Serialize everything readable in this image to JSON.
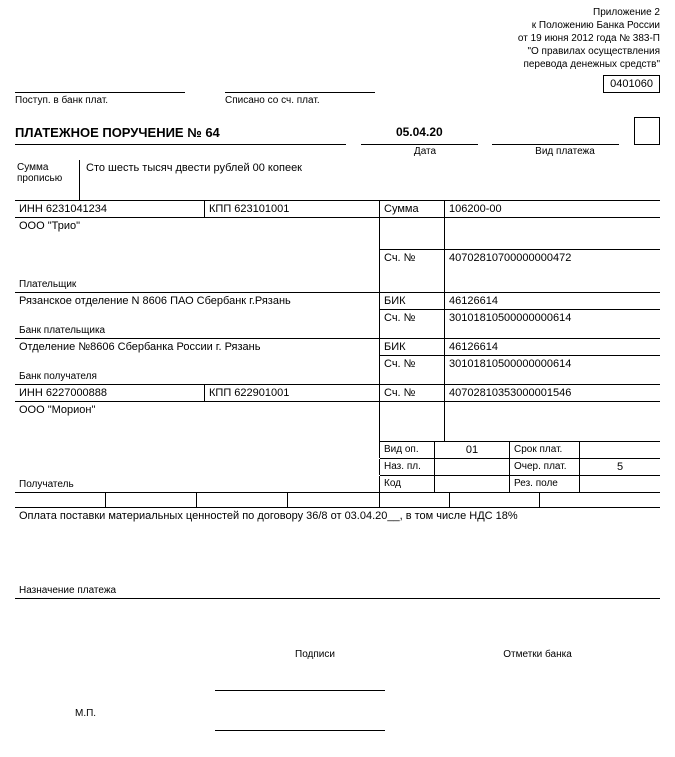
{
  "header": {
    "l1": "Приложение 2",
    "l2": "к Положению Банка России",
    "l3": "от 19 июня 2012 года № 383-П",
    "l4": "\"О правилах осуществления",
    "l5": "перевода денежных средств\"",
    "code": "0401060"
  },
  "stamp": {
    "left": "Поступ. в банк плат.",
    "mid": "Списано со сч. плат."
  },
  "title": {
    "main": "ПЛАТЕЖНОЕ ПОРУЧЕНИЕ № 64",
    "date": "05.04.20",
    "date_label": "Дата",
    "type_label": "Вид платежа"
  },
  "sumwords": {
    "label_l1": "Сумма",
    "label_l2": "прописью",
    "value": "Сто шесть тысяч двести рублей 00 копеек"
  },
  "payer": {
    "inn": "ИНН 6231041234",
    "kpp": "КПП 623101001",
    "name": "ООО \"Трио\"",
    "label": "Плательщик"
  },
  "sum": {
    "label": "Сумма",
    "value": "106200-00"
  },
  "payer_acc": {
    "label": "Сч. №",
    "value": "40702810700000000472"
  },
  "payer_bank": {
    "name": "Рязанское отделение N 8606 ПАО Сбербанк г.Рязань",
    "label": "Банк плательщика",
    "bik_label": "БИК",
    "bik": "46126614",
    "acc_label": "Сч. №",
    "acc": "30101810500000000614"
  },
  "rec_bank": {
    "name": "Отделение №8606 Сбербанка России г. Рязань",
    "label": "Банк получателя",
    "bik_label": "БИК",
    "bik": "46126614",
    "acc_label": "Сч. №",
    "acc": "30101810500000000614"
  },
  "rec": {
    "inn": "ИНН 6227000888",
    "kpp": "КПП 622901001",
    "acc_label": "Сч. №",
    "acc": "40702810353000001546",
    "name": "ООО \"Морион\"",
    "label": "Получатель"
  },
  "op": {
    "vid_op": "Вид оп.",
    "vid_op_v": "01",
    "naz_pl": "Наз. пл.",
    "kod": "Код",
    "srok": "Срок плат.",
    "ocher": "Очер. плат.",
    "ocher_v": "5",
    "rez": "Рез. поле"
  },
  "purpose": {
    "text": "Оплата поставки материальных ценностей по договору 36/8 от 03.04.20__, в том числе НДС 18%",
    "label": "Назначение платежа"
  },
  "footer": {
    "sign": "Подписи",
    "bank": "Отметки банка",
    "mp": "М.П."
  }
}
